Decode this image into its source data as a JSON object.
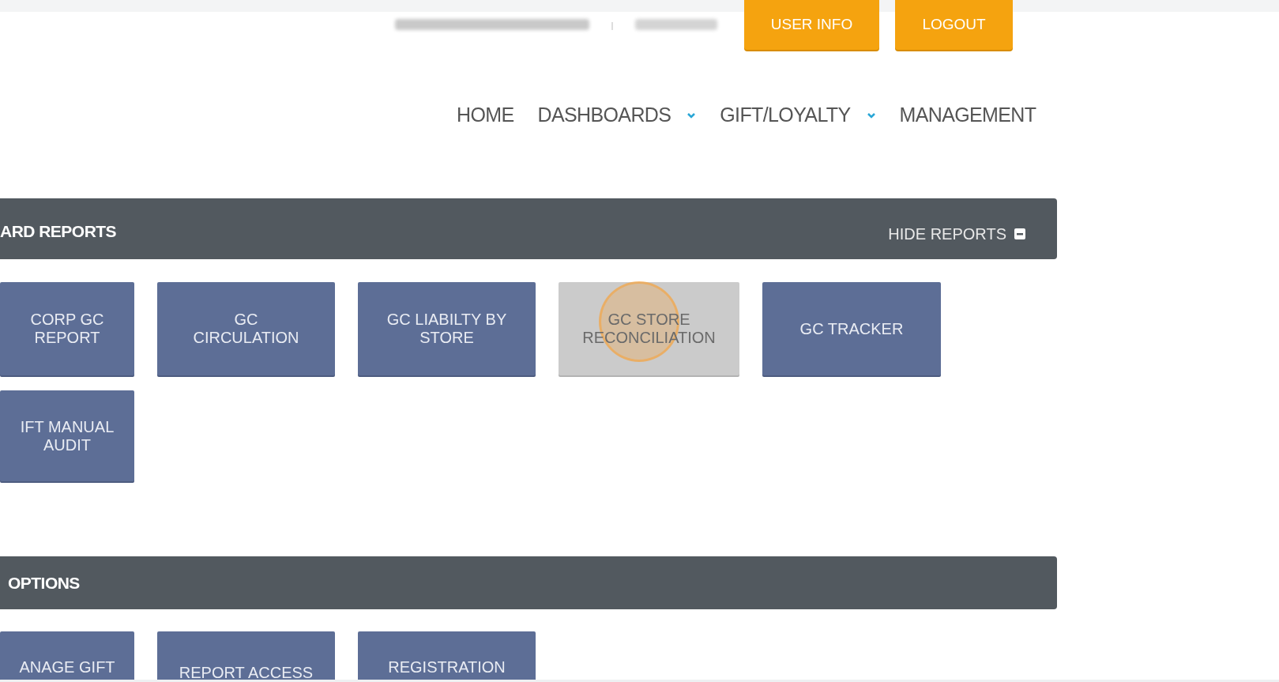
{
  "header": {
    "buttons": [
      "USER INFO",
      "LOGOUT"
    ]
  },
  "nav": [
    {
      "label": "HOME",
      "dropdown": false
    },
    {
      "label": "DASHBOARDS",
      "dropdown": true
    },
    {
      "label": "GIFT/LOYALTY",
      "dropdown": true
    },
    {
      "label": "MANAGEMENT",
      "dropdown": false
    }
  ],
  "sections": [
    {
      "title": "ARD REPORTS",
      "toggle": "HIDE REPORTS",
      "items": [
        {
          "lines": [
            "CORP GC",
            "REPORT"
          ],
          "disabled": false,
          "clicked": false
        },
        {
          "lines": [
            "GC",
            "CIRCULATION"
          ],
          "disabled": false,
          "clicked": false
        },
        {
          "lines": [
            "GC LIABILTY BY",
            "STORE"
          ],
          "disabled": false,
          "clicked": false
        },
        {
          "lines": [
            "GC STORE",
            "RECONCILIATION"
          ],
          "disabled": true,
          "clicked": true
        },
        {
          "lines": [
            "GC TRACKER"
          ],
          "disabled": false,
          "clicked": false
        },
        {
          "lines": [
            "IFT MANUAL",
            "AUDIT"
          ],
          "disabled": false,
          "clicked": false
        }
      ]
    },
    {
      "title": "OPTIONS",
      "items": [
        {
          "lines": [
            "ANAGE GIFT"
          ],
          "disabled": false,
          "clicked": false
        },
        {
          "lines": [
            "REPORT ACCESS"
          ],
          "disabled": false,
          "clicked": false
        },
        {
          "lines": [
            "REGISTRATION"
          ],
          "disabled": false,
          "clicked": false
        }
      ]
    }
  ]
}
